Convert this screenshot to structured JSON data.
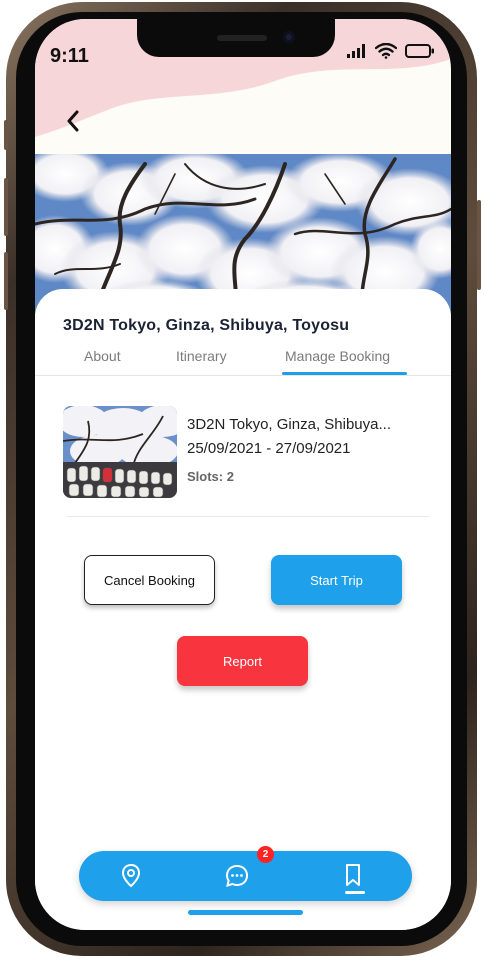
{
  "status_bar": {
    "time": "9:11"
  },
  "trip": {
    "title": "3D2N  Tokyo, Ginza, Shibuya, Toyosu"
  },
  "tabs": [
    {
      "label": "About"
    },
    {
      "label": "Itinerary"
    },
    {
      "label": "Manage Booking",
      "active": true
    }
  ],
  "booking": {
    "name": "3D2N Tokyo, Ginza, Shibuya...",
    "dates": "25/09/2021 - 27/09/2021",
    "slots": "Slots: 2"
  },
  "actions": {
    "cancel_label": "Cancel Booking",
    "start_label": "Start Trip",
    "report_label": "Report"
  },
  "bottom_nav": {
    "items": [
      {
        "icon": "location-pin-icon"
      },
      {
        "icon": "chat-bubble-icon",
        "badge": "2"
      },
      {
        "icon": "bookmark-icon",
        "active": true
      }
    ]
  },
  "colors": {
    "accent": "#1ea0ea",
    "danger": "#f8353f",
    "wave": "#f6d6d9",
    "badge": "#ff2323"
  }
}
